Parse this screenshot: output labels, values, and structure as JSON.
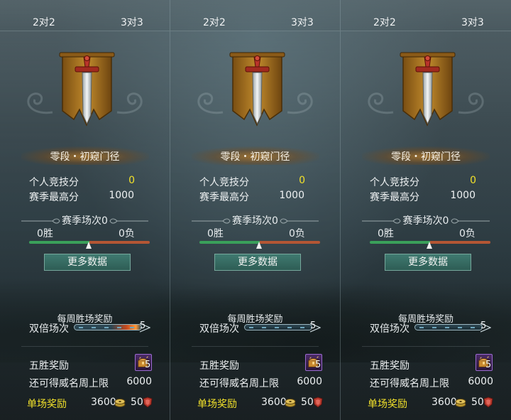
{
  "panels": [
    {
      "tabs": [
        "2对2",
        "3对3"
      ],
      "rank": "零段・初窥门径",
      "personal_score_label": "个人竞技分",
      "personal_score": "0",
      "season_high_label": "赛季最高分",
      "season_high": "1000",
      "season_matches": "赛季场次0",
      "wins": "0胜",
      "losses": "0负",
      "more_button": "更多数据",
      "weekly_reward_title": "每周胜场奖励",
      "double_label": "双倍场次",
      "double_count": "5",
      "five_win_label": "五胜奖励",
      "five_win_count": "5",
      "prestige_label": "还可得威名周上限",
      "prestige_value": "6000",
      "single_reward_label": "单场奖励",
      "single_reward_coins": "3600",
      "single_reward_honor": "50"
    },
    {
      "tabs": [
        "2对2",
        "3对3"
      ],
      "rank": "零段・初窥门径",
      "personal_score_label": "个人竞技分",
      "personal_score": "0",
      "season_high_label": "赛季最高分",
      "season_high": "1000",
      "season_matches": "赛季场次0",
      "wins": "0胜",
      "losses": "0负",
      "more_button": "更多数据",
      "weekly_reward_title": "每周胜场奖励",
      "double_label": "双倍场次",
      "double_count": "5",
      "five_win_label": "五胜奖励",
      "five_win_count": "5",
      "prestige_label": "还可得威名周上限",
      "prestige_value": "6000",
      "single_reward_label": "单场奖励",
      "single_reward_coins": "3600",
      "single_reward_honor": "50"
    },
    {
      "tabs": [
        "2对2",
        "3对3"
      ],
      "rank": "零段・初窥门径",
      "personal_score_label": "个人竞技分",
      "personal_score": "0",
      "season_high_label": "赛季最高分",
      "season_high": "1000",
      "season_matches": "赛季场次0",
      "wins": "0胜",
      "losses": "0负",
      "more_button": "更多数据",
      "weekly_reward_title": "每周胜场奖励",
      "double_label": "双倍场次",
      "double_count": "5",
      "five_win_label": "五胜奖励",
      "five_win_count": "5",
      "prestige_label": "还可得威名周上限",
      "prestige_value": "6000",
      "single_reward_label": "单场奖励",
      "single_reward_coins": "3600",
      "single_reward_honor": "50"
    }
  ],
  "colors": {
    "highlight": "#f2e12a",
    "win_bar": "#3aa05a",
    "loss_bar": "#b45634",
    "button": "#3f7a70",
    "banner": "#b07a2a"
  },
  "icons": [
    "sword-banner-icon",
    "treasure-chest-icon",
    "coin-icon",
    "honor-shield-icon"
  ]
}
